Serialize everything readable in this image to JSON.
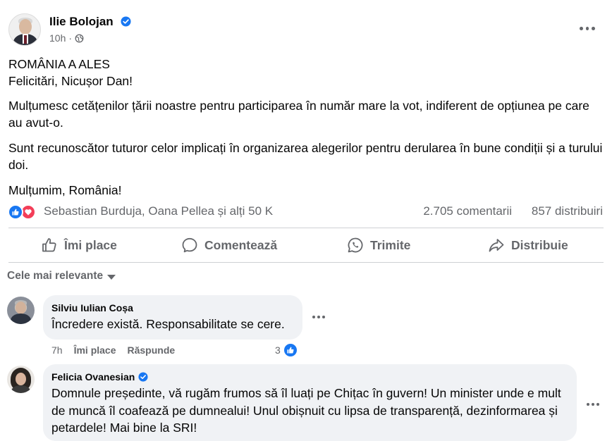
{
  "post": {
    "author": "Ilie Bolojan",
    "time": "10h",
    "lines": [
      "ROMÂNIA A ALES",
      "Felicitări, Nicușor Dan!",
      "Mulțumesc cetățenilor țării noastre pentru participarea în număr mare la vot, indiferent de opțiunea pe care au avut-o.",
      "Sunt recunoscător tuturor celor implicați în organizarea alegerilor pentru derularea în bune condiții și a turului doi.",
      "Mulțumim, România!"
    ],
    "reactions_text": "Sebastian Burduja, Oana Pellea și alți 50 K",
    "comments_count": "2.705 comentarii",
    "shares_count": "857 distribuiri"
  },
  "actions": {
    "like": "Îmi place",
    "comment": "Comentează",
    "send": "Trimite",
    "share": "Distribuie"
  },
  "filter": {
    "label": "Cele mai relevante"
  },
  "comments": [
    {
      "author": "Silviu Iulian Coșa",
      "text": "Încredere există. Responsabilitate se cere.",
      "time": "7h",
      "like": "Îmi place",
      "reply": "Răspunde",
      "likes": "3"
    },
    {
      "author": "Felicia Ovanesian",
      "text": "Domnule președinte, vă rugăm frumos să îl luați pe Chițac în guvern! Un minister unde e mult de muncă îl coafează pe dumnealui! Unul obișnuit cu lipsa de transparență, dezinformarea și petardele! Mai bine la SRI!"
    }
  ],
  "colors": {
    "text": "#050505",
    "secondary": "#65676b",
    "brand_blue": "#1877f2",
    "love_red": "#f33e58",
    "bubble": "#f0f2f5",
    "divider": "#ced0d4"
  },
  "icons": [
    "verified-badge-icon",
    "globe-icon",
    "more-icon",
    "like-reaction-icon",
    "love-reaction-icon",
    "thumbs-up-icon",
    "comment-icon",
    "whatsapp-icon",
    "share-icon",
    "caret-down-icon"
  ]
}
